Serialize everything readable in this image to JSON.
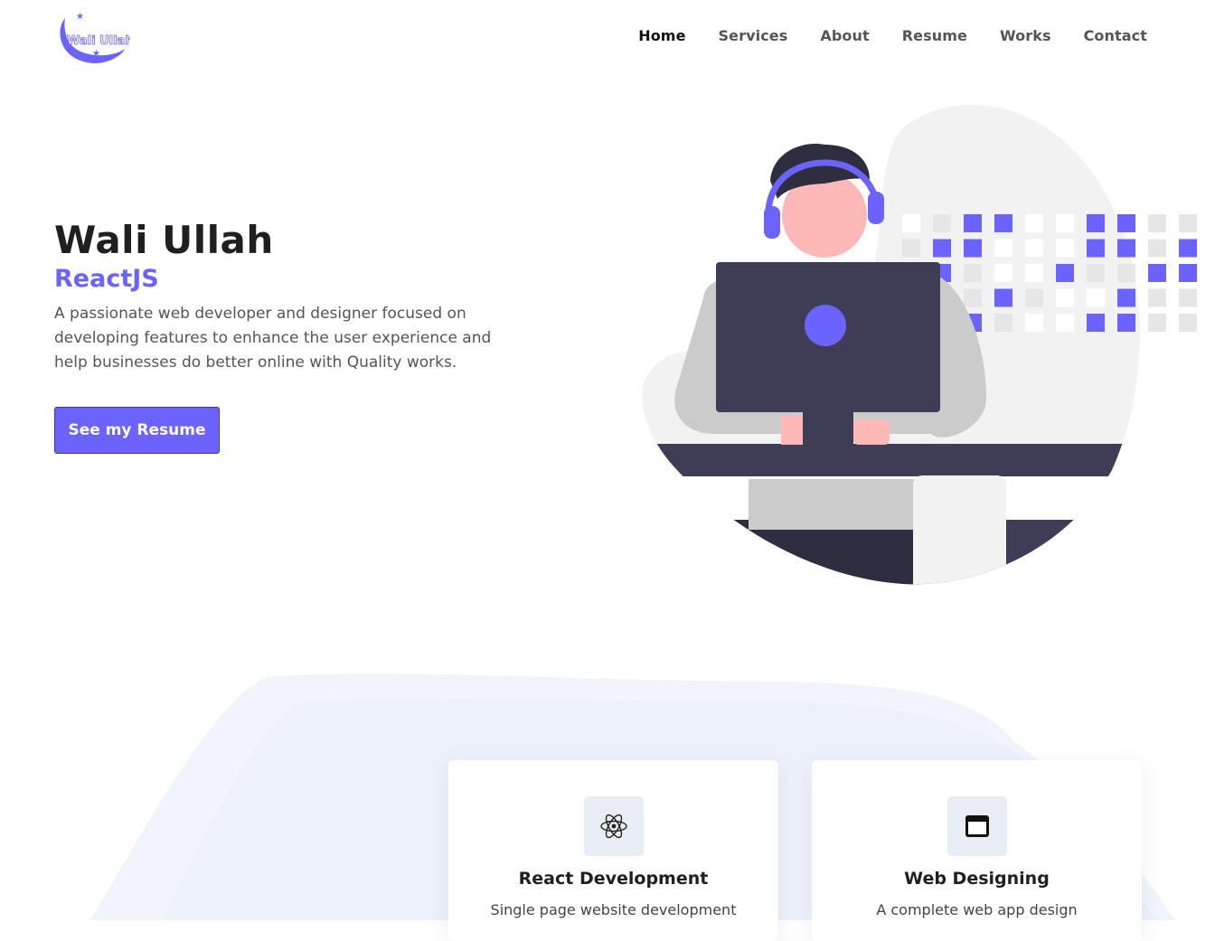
{
  "brand": {
    "logo_text": "Wali Ullah",
    "accent": "#6c63ff"
  },
  "nav": {
    "items": [
      {
        "label": "Home"
      },
      {
        "label": "Services"
      },
      {
        "label": "About"
      },
      {
        "label": "Resume"
      },
      {
        "label": "Works"
      },
      {
        "label": "Contact"
      }
    ]
  },
  "hero": {
    "name": "Wali Ullah",
    "role": "ReactJS",
    "description": "A passionate web developer and designer focused on developing features to enhance the user experience and help businesses do better online with Quality works.",
    "cta_label": "See my Resume"
  },
  "services": {
    "cards": [
      {
        "title": "React Development",
        "description": "Single page website development",
        "icon": "react-atom-icon"
      },
      {
        "title": "Web Designing",
        "description": "A complete web app design",
        "icon": "browser-window-icon"
      }
    ]
  }
}
